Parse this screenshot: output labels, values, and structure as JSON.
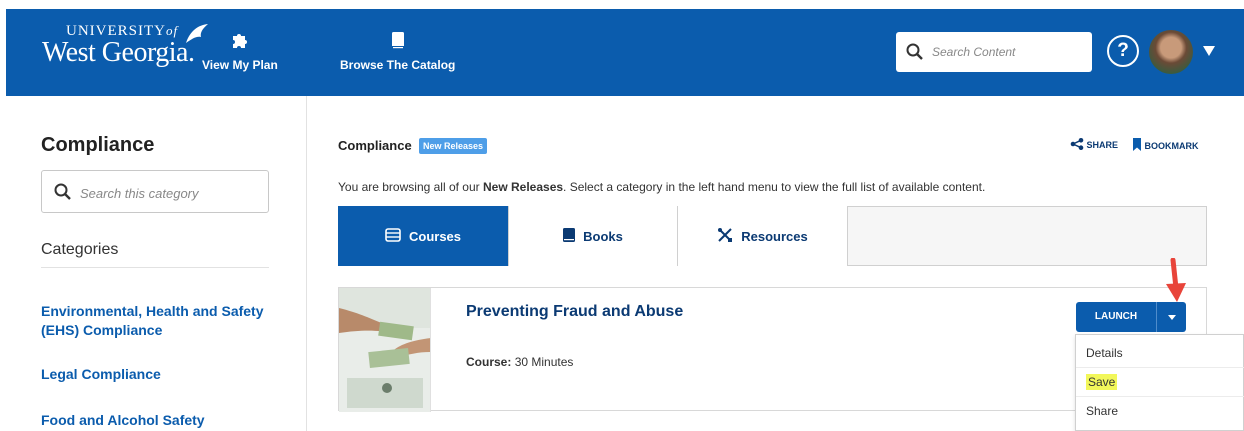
{
  "header": {
    "logo_line1": "UNIVERSITY",
    "logo_of": "of",
    "logo_line2": "West Georgia.",
    "nav": [
      {
        "label": "View My Plan",
        "icon": "puzzle-icon"
      },
      {
        "label": "Browse The Catalog",
        "icon": "book-icon"
      }
    ],
    "search_placeholder": "Search Content",
    "help_label": "?",
    "colors": {
      "brand": "#0b5cad"
    }
  },
  "sidebar": {
    "title": "Compliance",
    "search_placeholder": "Search this category",
    "categories_heading": "Categories",
    "categories": [
      "Environmental, Health and Safety (EHS) Compliance",
      "Legal Compliance",
      "Food and Alcohol Safety"
    ]
  },
  "main": {
    "title": "Compliance",
    "badge": "New Releases",
    "share_label": "SHARE",
    "bookmark_label": "BOOKMARK",
    "browse_prefix": "You are browsing all of our ",
    "browse_bold": "New Releases",
    "browse_suffix": ". Select a category in the left hand menu to view the full list of available content.",
    "tabs": [
      {
        "label": "Courses",
        "icon": "courses-icon",
        "active": true
      },
      {
        "label": "Books",
        "icon": "book-icon",
        "active": false
      },
      {
        "label": "Resources",
        "icon": "tools-icon",
        "active": false
      }
    ]
  },
  "card": {
    "title": "Preventing Fraud and Abuse",
    "meta_label": "Course:",
    "meta_value": "30 Minutes",
    "launch_label": "LAUNCH"
  },
  "dropdown": {
    "items": [
      "Details",
      "Save",
      "Share"
    ],
    "highlight_color": "#f2f75a"
  },
  "annotation": {
    "arrow_color": "#e8443a"
  }
}
